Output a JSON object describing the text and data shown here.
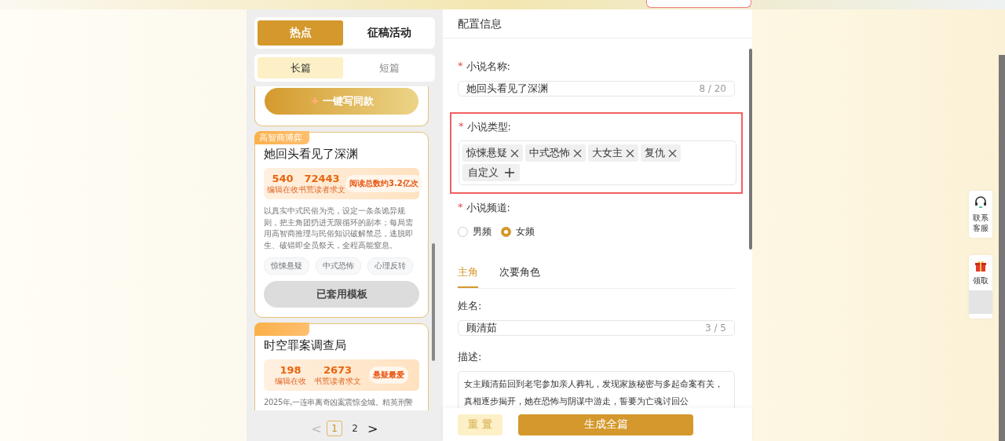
{
  "left_panel": {
    "tabs": [
      {
        "label": "热点",
        "selected": true
      },
      {
        "label": "征稿活动",
        "selected": false
      }
    ],
    "segments": [
      {
        "label": "长篇",
        "selected": true
      },
      {
        "label": "短篇",
        "selected": false
      }
    ],
    "cards": [
      {
        "kind": "partial",
        "button": {
          "label": "一键写同款",
          "applied": false
        }
      },
      {
        "kind": "full",
        "ribbon": "高智商博弈",
        "title": "她回头看见了深渊",
        "stats": [
          {
            "value": "540",
            "label": "编辑在收"
          },
          {
            "value": "72443",
            "label": "书荒读者求文"
          }
        ],
        "badge": "阅读总数约3.2亿次",
        "description": "以真实中式民俗为壳，设定一条条诡异规则，把主角团扔进无限循环的副本；每局需用高智商推理与民俗知识破解禁忌，逃脱即生、破错即全员祭天，全程高能窒息。",
        "tags": [
          "惊悚悬疑",
          "中式恐怖",
          "心理反转"
        ],
        "button": {
          "label": "已套用模板",
          "applied": true
        }
      },
      {
        "kind": "cut",
        "title": "时空罪案调查局",
        "stats": [
          {
            "value": "198",
            "label": "编辑在收"
          },
          {
            "value": "2673",
            "label": "书荒读者求文"
          }
        ],
        "badge": "悬疑最爱",
        "description": "2025年,一连串离奇凶案震惊全城。精英刑警"
      }
    ],
    "pagination": {
      "pages": [
        {
          "label": "1",
          "selected": true
        },
        {
          "label": "2",
          "selected": false
        }
      ],
      "prev": "<",
      "next": ">"
    }
  },
  "config": {
    "title": "配置信息",
    "name_field": {
      "label": "小说名称:",
      "required": true,
      "required_mark": "*",
      "value": "她回头看见了深渊",
      "count": "8 / 20"
    },
    "genre_field": {
      "label": "小说类型:",
      "required": true,
      "required_mark": "*",
      "highlighted": true,
      "tags": [
        "惊悚悬疑",
        "中式恐怖",
        "大女主",
        "复仇"
      ],
      "custom": "自定义"
    },
    "channel_field": {
      "label": "小说频道:",
      "required": true,
      "required_mark": "*",
      "options": [
        {
          "label": "男频",
          "selected": false
        },
        {
          "label": "女频",
          "selected": true
        }
      ]
    },
    "role_tabs": [
      {
        "label": "主角",
        "selected": true
      },
      {
        "label": "次要角色",
        "selected": false
      }
    ],
    "role_name": {
      "label": "姓名:",
      "value": "顾清茹",
      "count": "3 / 5"
    },
    "role_description": {
      "label": "描述:",
      "value": "女主顾清茹回到老宅参加亲人葬礼，发现家族秘密与多起命案有关，真相逐步揭开，她在恐怖与阴谋中游走，誓要为亡魂讨回公"
    },
    "reset_button": {
      "label": "重 置",
      "disabled": true
    },
    "generate_button": {
      "label": "生成全篇"
    }
  },
  "float_widget": [
    {
      "kind": "service",
      "label": "联系客服"
    },
    {
      "kind": "gift",
      "label": "领取"
    }
  ]
}
